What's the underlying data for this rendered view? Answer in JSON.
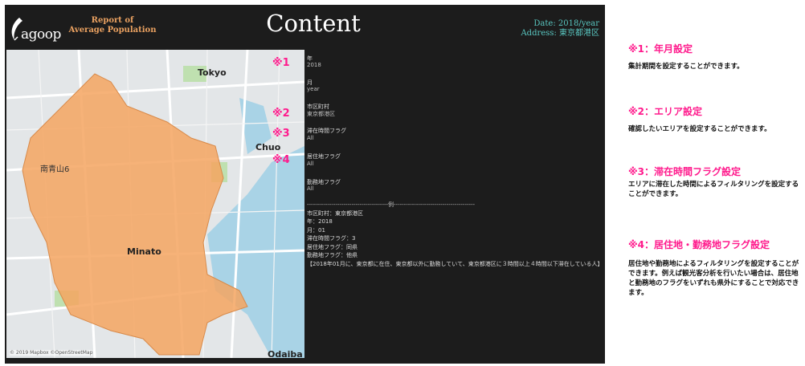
{
  "header": {
    "logo_text": "agoop",
    "report_line1": "Report of",
    "report_line2": "Average Population",
    "title": "Content",
    "date_label": "Date: 2018/year",
    "address_label": "Address: 東京都港区"
  },
  "map": {
    "labels": [
      "Tokyo",
      "Chuo",
      "南青山6",
      "Minato",
      "Odaiba"
    ],
    "credit": "© 2019 Mapbox ©OpenStreetMap",
    "area_color": "#f4a460"
  },
  "markers": [
    "※1",
    "※2",
    "※3",
    "※4"
  ],
  "filters": [
    {
      "label": "年",
      "value": "2018"
    },
    {
      "label": "月",
      "value": "year"
    },
    {
      "label": "市区町村",
      "value": "東京都港区"
    },
    {
      "label": "滞在時間フラグ",
      "value": "All"
    },
    {
      "label": "居住地フラグ",
      "value": "All"
    },
    {
      "label": "勤務地フラグ",
      "value": "All"
    }
  ],
  "example": {
    "separator": "----------------------------------------例----------------------------------------",
    "lines": [
      "市区町村：東京都港区",
      "年：2018",
      "月：01",
      "滞在時間フラグ：3",
      "居住地フラグ：同県",
      "勤務地フラグ：他県"
    ],
    "summary": "【2018年01月に、東京都に在住、東京都以外に勤務していて、東京都港区に３時間以上４時間以下滞在している人】"
  },
  "notes": [
    {
      "heading": "※1：年月設定",
      "body": "集計期間を設定することができます。"
    },
    {
      "heading": "※2：エリア設定",
      "body": "確認したいエリアを設定することができます。"
    },
    {
      "heading": "※3：滞在時間フラグ設定",
      "body": "エリアに滞在した時間によるフィルタリングを設定することができます。"
    },
    {
      "heading": "※4：居住地・勤務地フラグ設定",
      "body": "居住地や勤務地によるフィルタリングを設定することができます。例えば観光客分析を行いたい場合は、居住地と勤務地のフラグをいずれも県外にすることで対応できます。"
    }
  ]
}
